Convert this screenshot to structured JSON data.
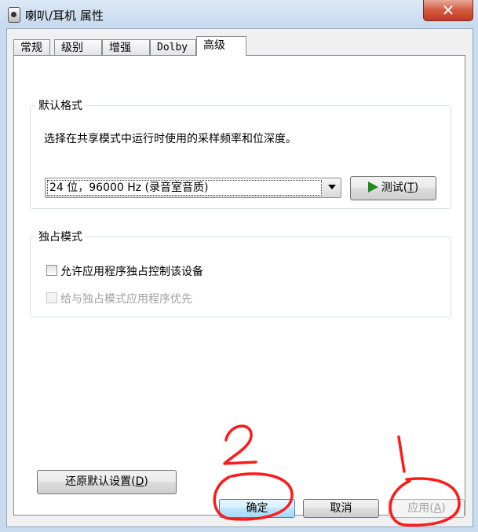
{
  "window": {
    "title": "喇叭/耳机 属性",
    "close": "✕"
  },
  "tabs": [
    {
      "label": "常规"
    },
    {
      "label": "级别"
    },
    {
      "label": "增强"
    },
    {
      "label": "Dolby"
    },
    {
      "label": "高级"
    }
  ],
  "default_format": {
    "legend": "默认格式",
    "description": "选择在共享模式中运行时使用的采样频率和位深度。",
    "selected": "24 位，96000 Hz (录音室音质)",
    "test_prefix": "测试(",
    "test_key": "T",
    "test_suffix": ")"
  },
  "exclusive_mode": {
    "legend": "独占模式",
    "allow_label": "允许应用程序独占控制该设备",
    "allow_checked": false,
    "priority_label": "给与独占模式应用程序优先",
    "priority_checked": false
  },
  "restore": {
    "prefix": "还原默认设置(",
    "key": "D",
    "suffix": ")"
  },
  "footer": {
    "ok": "确定",
    "cancel": "取消",
    "apply_prefix": "应用(",
    "apply_key": "A",
    "apply_suffix": ")"
  },
  "annotations": [
    "2",
    "1"
  ]
}
